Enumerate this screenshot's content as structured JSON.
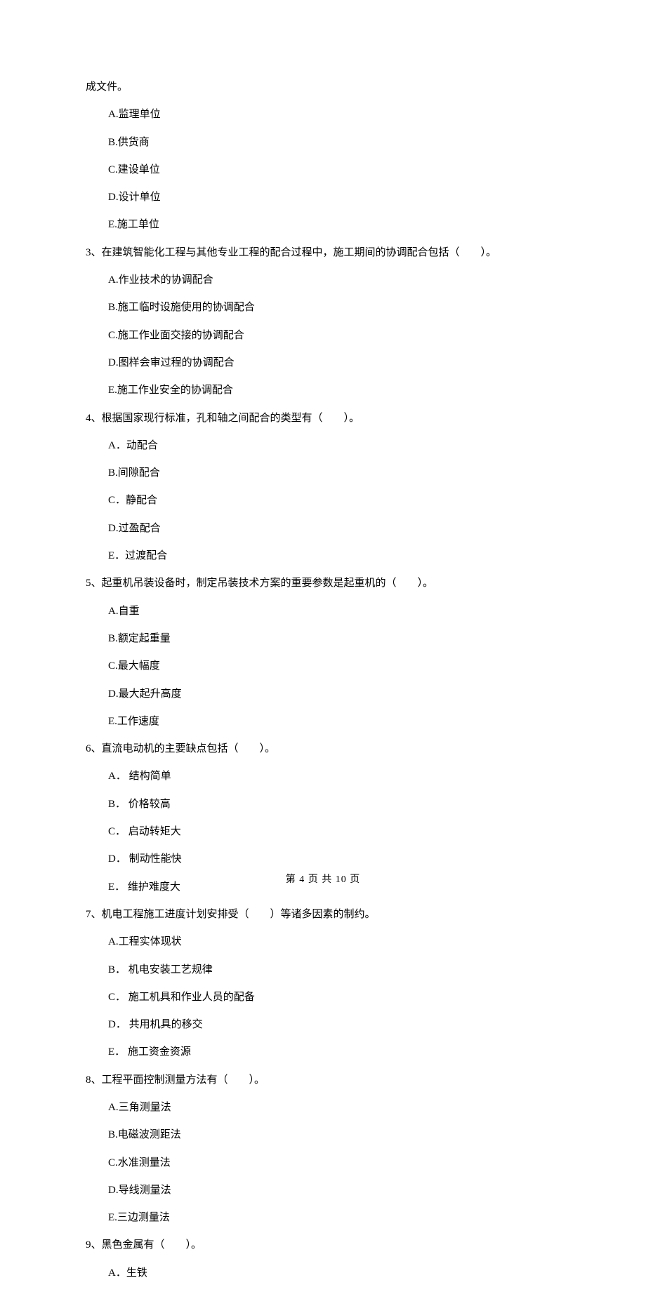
{
  "fragment_line": "成文件。",
  "fragment_options": [
    "A.监理单位",
    "B.供货商",
    "C.建设单位",
    "D.设计单位",
    "E.施工单位"
  ],
  "questions": [
    {
      "num": "3、",
      "stem": "在建筑智能化工程与其他专业工程的配合过程中，施工期间的协调配合包括（　　）。",
      "options": [
        "A.作业技术的协调配合",
        "B.施工临时设施使用的协调配合",
        "C.施工作业面交接的协调配合",
        "D.图样会审过程的协调配合",
        "E.施工作业安全的协调配合"
      ]
    },
    {
      "num": "4、",
      "stem": "根据国家现行标准，孔和轴之间配合的类型有（　　）。",
      "options": [
        "A．动配合",
        "B.间隙配合",
        "C．静配合",
        "D.过盈配合",
        "E．过渡配合"
      ]
    },
    {
      "num": "5、",
      "stem": "起重机吊装设备时，制定吊装技术方案的重要参数是起重机的（　　）。",
      "options": [
        "A.自重",
        "B.额定起重量",
        "C.最大幅度",
        "D.最大起升高度",
        "E.工作速度"
      ]
    },
    {
      "num": "6、",
      "stem": "直流电动机的主要缺点包括（　　）。",
      "options": [
        "A． 结构简单",
        "B． 价格较高",
        "C． 启动转矩大",
        "D． 制动性能快",
        "E． 维护难度大"
      ]
    },
    {
      "num": "7、",
      "stem": "机电工程施工进度计划安排受（　　）等诸多因素的制约。",
      "options": [
        "A.工程实体现状",
        "B． 机电安装工艺规律",
        "C． 施工机具和作业人员的配备",
        "D． 共用机具的移交",
        "E． 施工资金资源"
      ]
    },
    {
      "num": "8、",
      "stem": "工程平面控制测量方法有（　　）。",
      "options": [
        "A.三角测量法",
        "B.电磁波测距法",
        "C.水准测量法",
        "D.导线测量法",
        "E.三边测量法"
      ]
    },
    {
      "num": "9、",
      "stem": "黑色金属有（　　）。",
      "options": [
        "A．生铁"
      ]
    }
  ],
  "footer": "第 4 页 共 10 页"
}
